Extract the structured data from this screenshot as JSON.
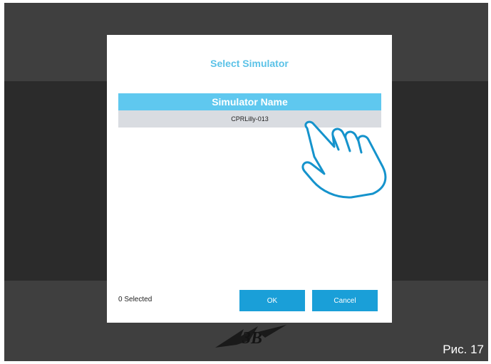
{
  "dialog": {
    "title": "Select Simulator",
    "column_header": "Simulator Name",
    "rows": [
      "CPRLilly-013"
    ],
    "selected_count": "0 Selected",
    "ok_label": "OK",
    "cancel_label": "Cancel"
  },
  "figure_label": "Рис. 17",
  "colors": {
    "accent": "#5bc2e7",
    "button": "#1a9fd8",
    "row_bg": "#d9dce1",
    "backdrop": "#2b2b2b"
  },
  "icons": [
    "pointing-hand-icon",
    "brand-logo"
  ]
}
